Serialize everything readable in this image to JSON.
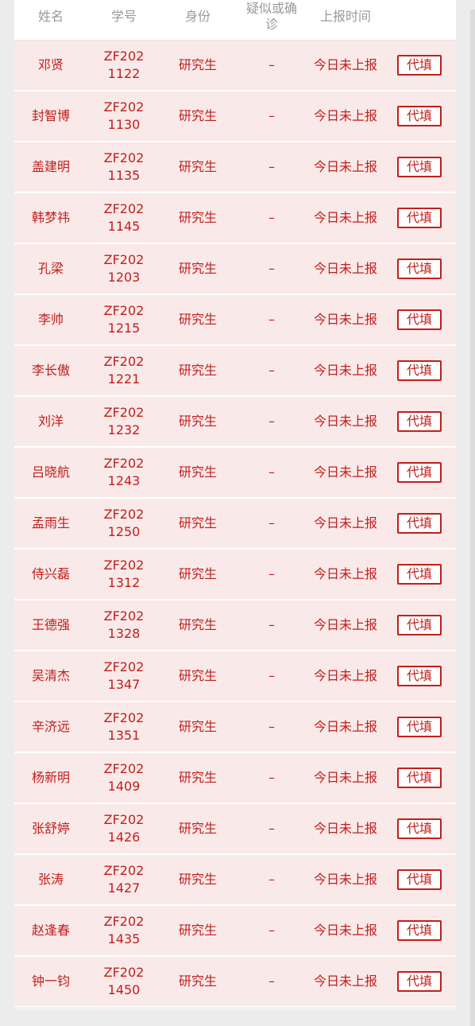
{
  "table": {
    "headers": {
      "name": "姓名",
      "student_id": "学号",
      "role": "身份",
      "diagnosis_line1": "疑似或确",
      "diagnosis_line2": "诊",
      "report_time": "上报时间"
    },
    "action_label": "代填",
    "rows": [
      {
        "name": "邓贤",
        "student_id": "ZF2021122",
        "role": "研究生",
        "diagnosis": "–",
        "report_time": "今日未上报"
      },
      {
        "name": "封智博",
        "student_id": "ZF2021130",
        "role": "研究生",
        "diagnosis": "–",
        "report_time": "今日未上报"
      },
      {
        "name": "盖建明",
        "student_id": "ZF2021135",
        "role": "研究生",
        "diagnosis": "–",
        "report_time": "今日未上报"
      },
      {
        "name": "韩梦祎",
        "student_id": "ZF2021145",
        "role": "研究生",
        "diagnosis": "–",
        "report_time": "今日未上报"
      },
      {
        "name": "孔梁",
        "student_id": "ZF2021203",
        "role": "研究生",
        "diagnosis": "–",
        "report_time": "今日未上报"
      },
      {
        "name": "李帅",
        "student_id": "ZF2021215",
        "role": "研究生",
        "diagnosis": "–",
        "report_time": "今日未上报"
      },
      {
        "name": "李长傲",
        "student_id": "ZF2021221",
        "role": "研究生",
        "diagnosis": "–",
        "report_time": "今日未上报"
      },
      {
        "name": "刘洋",
        "student_id": "ZF2021232",
        "role": "研究生",
        "diagnosis": "–",
        "report_time": "今日未上报"
      },
      {
        "name": "吕晓航",
        "student_id": "ZF2021243",
        "role": "研究生",
        "diagnosis": "–",
        "report_time": "今日未上报"
      },
      {
        "name": "孟雨生",
        "student_id": "ZF2021250",
        "role": "研究生",
        "diagnosis": "–",
        "report_time": "今日未上报"
      },
      {
        "name": "侍兴磊",
        "student_id": "ZF2021312",
        "role": "研究生",
        "diagnosis": "–",
        "report_time": "今日未上报"
      },
      {
        "name": "王德强",
        "student_id": "ZF2021328",
        "role": "研究生",
        "diagnosis": "–",
        "report_time": "今日未上报"
      },
      {
        "name": "吴清杰",
        "student_id": "ZF2021347",
        "role": "研究生",
        "diagnosis": "–",
        "report_time": "今日未上报"
      },
      {
        "name": "辛济远",
        "student_id": "ZF2021351",
        "role": "研究生",
        "diagnosis": "–",
        "report_time": "今日未上报"
      },
      {
        "name": "杨新明",
        "student_id": "ZF2021409",
        "role": "研究生",
        "diagnosis": "–",
        "report_time": "今日未上报"
      },
      {
        "name": "张舒婷",
        "student_id": "ZF2021426",
        "role": "研究生",
        "diagnosis": "–",
        "report_time": "今日未上报"
      },
      {
        "name": "张涛",
        "student_id": "ZF2021427",
        "role": "研究生",
        "diagnosis": "–",
        "report_time": "今日未上报"
      },
      {
        "name": "赵逢春",
        "student_id": "ZF2021435",
        "role": "研究生",
        "diagnosis": "–",
        "report_time": "今日未上报"
      },
      {
        "name": "钟一钧",
        "student_id": "ZF2021450",
        "role": "研究生",
        "diagnosis": "–",
        "report_time": "今日未上报"
      }
    ]
  },
  "colors": {
    "accent_red": "#c0201c",
    "row_background": "#fae9e9",
    "header_text": "#9a9a9a"
  }
}
